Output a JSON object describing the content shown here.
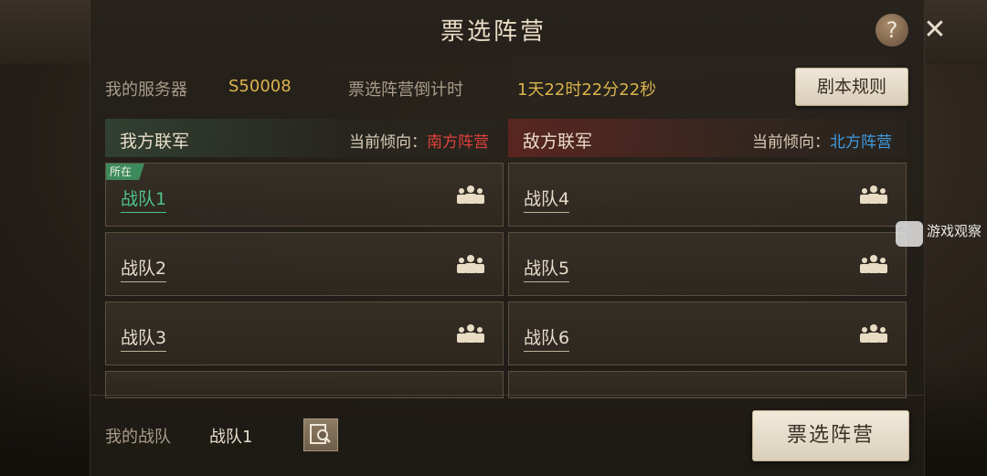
{
  "header": {
    "title": "票选阵营",
    "help_label": "?",
    "close_label": "✕"
  },
  "info": {
    "server_label": "我的服务器",
    "server_value": "S50008",
    "countdown_label": "票选阵营倒计时",
    "countdown_value": "1天22时22分22秒",
    "rules_button": "剧本规则"
  },
  "left_column": {
    "title": "我方联军",
    "tendency_label": "当前倾向：",
    "tendency_value": "南方阵营",
    "current_tag": "所在",
    "teams": [
      "战队1",
      "战队2",
      "战队3"
    ]
  },
  "right_column": {
    "title": "敌方联军",
    "tendency_label": "当前倾向：",
    "tendency_value": "北方阵营",
    "teams": [
      "战队4",
      "战队5",
      "战队6"
    ]
  },
  "footer": {
    "my_team_label": "我的战队",
    "my_team_value": "战队1",
    "vote_button": "票选阵营"
  },
  "icons": {
    "members": "team-members-icon",
    "search": "magnifier-icon",
    "help": "question-icon",
    "close": "close-icon"
  },
  "watermark": {
    "text": "游戏观察"
  },
  "colors": {
    "gold": "#d9b34c",
    "south_red": "#e0413a",
    "north_blue": "#3f9be0",
    "own_green": "#4fc38a"
  }
}
